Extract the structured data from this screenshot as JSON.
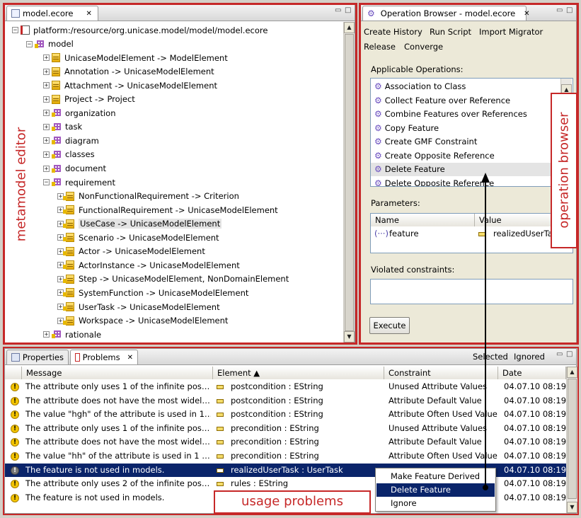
{
  "editor": {
    "tab_title": "model.ecore",
    "tab_close": "✕",
    "annotation": "metamodel editor",
    "tree": [
      {
        "label": "platform:/resource/org.unicase.model/model/model.ecore",
        "icon": "resource-icon",
        "expander": "−",
        "level": 0
      },
      {
        "label": "model",
        "icon": "package-icon",
        "expander": "−",
        "level": 1
      },
      {
        "label": "UnicaseModelElement -> ModelElement",
        "icon": "eclass-icon",
        "expander": "+",
        "level": 2
      },
      {
        "label": "Annotation -> UnicaseModelElement",
        "icon": "eclass-icon",
        "expander": "+",
        "level": 2
      },
      {
        "label": "Attachment -> UnicaseModelElement",
        "icon": "eclass-icon",
        "expander": "+",
        "level": 2
      },
      {
        "label": "Project -> Project",
        "icon": "eclass-icon",
        "expander": "+",
        "level": 2
      },
      {
        "label": "organization",
        "icon": "package-icon",
        "expander": "+",
        "level": 2
      },
      {
        "label": "task",
        "icon": "package-icon",
        "expander": "+",
        "level": 2
      },
      {
        "label": "diagram",
        "icon": "package-icon",
        "expander": "+",
        "level": 2
      },
      {
        "label": "classes",
        "icon": "package-icon",
        "expander": "+",
        "level": 2
      },
      {
        "label": "document",
        "icon": "package-icon",
        "expander": "+",
        "level": 2
      },
      {
        "label": "requirement",
        "icon": "package-icon",
        "expander": "−",
        "level": 2
      },
      {
        "label": "NonFunctionalRequirement -> Criterion",
        "icon": "eclass-icon",
        "expander": "+",
        "level": 3
      },
      {
        "label": "FunctionalRequirement -> UnicaseModelElement",
        "icon": "eclass-icon",
        "expander": "+",
        "level": 3
      },
      {
        "label": "UseCase -> UnicaseModelElement",
        "icon": "eclass-icon",
        "expander": "+",
        "level": 3,
        "selected": true
      },
      {
        "label": "Scenario -> UnicaseModelElement",
        "icon": "eclass-icon",
        "expander": "+",
        "level": 3
      },
      {
        "label": "Actor -> UnicaseModelElement",
        "icon": "eclass-icon",
        "expander": "+",
        "level": 3
      },
      {
        "label": "ActorInstance -> UnicaseModelElement",
        "icon": "eclass-icon",
        "expander": "+",
        "level": 3
      },
      {
        "label": "Step -> UnicaseModelElement, NonDomainElement",
        "icon": "eclass-icon",
        "expander": "+",
        "level": 3
      },
      {
        "label": "SystemFunction -> UnicaseModelElement",
        "icon": "eclass-icon",
        "expander": "+",
        "level": 3
      },
      {
        "label": "UserTask -> UnicaseModelElement",
        "icon": "eclass-icon",
        "expander": "+",
        "level": 3
      },
      {
        "label": "Workspace -> UnicaseModelElement",
        "icon": "eclass-icon",
        "expander": "+",
        "level": 3
      },
      {
        "label": "rationale",
        "icon": "package-icon",
        "expander": "+",
        "level": 2
      }
    ]
  },
  "browser": {
    "tab_title": "Operation Browser - model.ecore",
    "tab_close": "✕",
    "annotation": "operation browser",
    "menu": [
      "Create History",
      "Run Script",
      "Import Migrator",
      "Release",
      "Converge"
    ],
    "applicable_label": "Applicable Operations:",
    "operations": [
      "Association to Class",
      "Collect Feature over Reference",
      "Combine Features over References",
      "Copy Feature",
      "Create GMF Constraint",
      "Create Opposite Reference",
      "Delete Feature",
      "Delete Opposite Reference"
    ],
    "selected_operation": 6,
    "parameters_label": "Parameters:",
    "param_headers": [
      "Name",
      "Value"
    ],
    "params": [
      {
        "name": "feature",
        "value": "realizedUserTask"
      }
    ],
    "violated_label": "Violated constraints:",
    "execute_label": "Execute"
  },
  "problems": {
    "tabs": [
      {
        "label": "Properties"
      },
      {
        "label": "Problems",
        "active": true
      }
    ],
    "tab_close": "✕",
    "filters": [
      "Selected",
      "Ignored"
    ],
    "headers": [
      "Message",
      "Element ▲",
      "Constraint",
      "Date"
    ],
    "rows": [
      {
        "icon": "warning-icon",
        "message": "The attribute only uses 1 of the infinite pos…",
        "element": "postcondition : EString",
        "constraint": "Unused Attribute Values",
        "date": "04.07.10 08:19"
      },
      {
        "icon": "warning-icon",
        "message": "The attribute does not have the most widel…",
        "element": "postcondition : EString",
        "constraint": "Attribute Default Value",
        "date": "04.07.10 08:19"
      },
      {
        "icon": "warning-icon",
        "message": "The value \"hgh\" of the attribute is used in 1…",
        "element": "postcondition : EString",
        "constraint": "Attribute Often Used Value",
        "date": "04.07.10 08:19"
      },
      {
        "icon": "warning-icon",
        "message": "The attribute only uses 1 of the infinite pos…",
        "element": "precondition : EString",
        "constraint": "Unused Attribute Values",
        "date": "04.07.10 08:19"
      },
      {
        "icon": "warning-icon",
        "message": "The attribute does not have the most widel…",
        "element": "precondition : EString",
        "constraint": "Attribute Default Value",
        "date": "04.07.10 08:19"
      },
      {
        "icon": "warning-icon",
        "message": "The value \"hh\" of the attribute is used in 1 …",
        "element": "precondition : EString",
        "constraint": "Attribute Often Used Value",
        "date": "04.07.10 08:19"
      },
      {
        "icon": "warning-icon",
        "message": "The feature is not used in models.",
        "element": "realizedUserTask : UserTask",
        "constraint": "",
        "date": "04.07.10 08:19",
        "selected": true
      },
      {
        "icon": "warning-icon",
        "message": "The attribute only uses 2 of the infinite pos…",
        "element": "rules : EString",
        "constraint": "",
        "date": "04.07.10 08:19"
      },
      {
        "icon": "warning-icon",
        "message": "The feature is not used in models.",
        "element": "",
        "constraint": "",
        "date": "04.07.10 08:19"
      }
    ],
    "context_menu": [
      "Make Feature Derived",
      "Delete Feature",
      "Ignore"
    ],
    "context_selected": 1,
    "annotation": "usage problems"
  },
  "colors": {
    "annotation_red": "#c62828",
    "selection_blue": "#0a246a",
    "tree_selection": "#e4e4e4"
  }
}
